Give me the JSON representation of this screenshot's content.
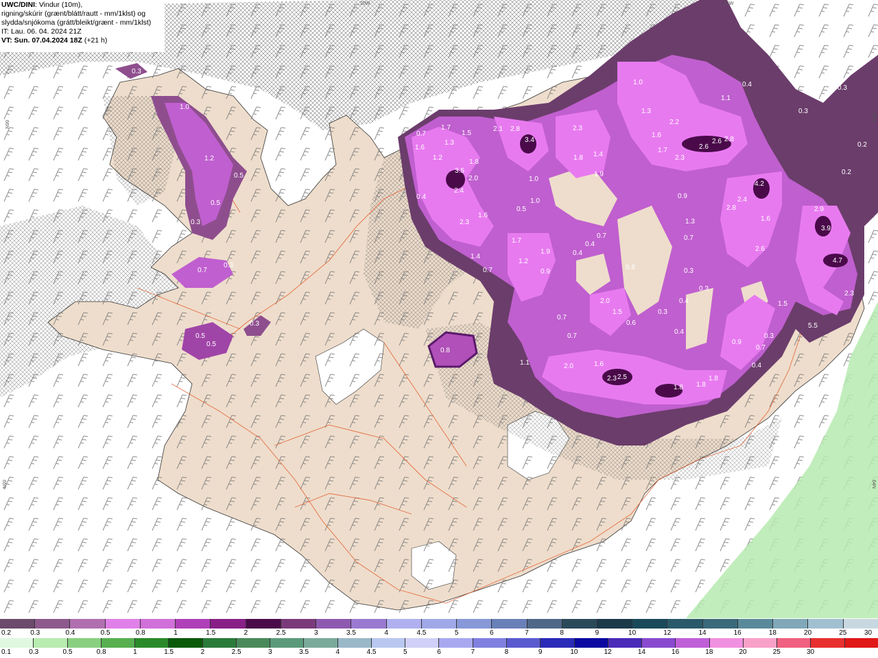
{
  "header": {
    "model": "UWC/DINI",
    "line1_rest": ": Vindur (10m),",
    "line2": "rigning/skúrir (grænt/blátt/rautt - mm/1klst) og",
    "line3": "slydda/snjókoma (grátt/bleikt/grænt - mm/1klst)",
    "init_time": "IT: Lau. 06. 04. 2024 21Z",
    "valid_time": "VT: Sun. 07.04.2024 18Z",
    "lead": "(+21 h)"
  },
  "map_ticks": {
    "top_left": "20W",
    "top_right": "15W",
    "left": "66N",
    "left_lower": "65N",
    "right": "66N",
    "right_lower": "64N"
  },
  "colors": {
    "land": "#eeddcc",
    "sea": "#ffffff",
    "barb": "#7a7a7a",
    "roads": "#e25a2a",
    "precip_light": "#7a3d7a",
    "precip_mid": "#c05fcf",
    "precip_high": "#e87af0",
    "precip_core": "#5a1a6a",
    "rain_green": "#b6eab0"
  },
  "value_labels": [
    "0.3",
    "1.0",
    "1.2",
    "0.5",
    "0.5",
    "0.3",
    "0.7",
    "0.3",
    "0.3",
    "0.5",
    "0.5",
    "0.8",
    "0.7",
    "1.7",
    "1.5",
    "1.6",
    "1.3",
    "1.2",
    "2.1",
    "2.8",
    "3.4",
    "3.5",
    "2.0",
    "1.8",
    "2.4",
    "0.4",
    "2.3",
    "1.6",
    "1.4",
    "0.7",
    "2.3",
    "1.8",
    "1.4",
    "1.9",
    "1.0",
    "0.5",
    "1.0",
    "1.7",
    "1.2",
    "1.9",
    "0.9",
    "1.0",
    "1.3",
    "1.1",
    "0.4",
    "0.3",
    "0.3",
    "0.2",
    "0.2",
    "2.2",
    "1.6",
    "1.7",
    "2.6",
    "2.6",
    "2.8",
    "2.3",
    "0.9",
    "4.2",
    "2.8",
    "2.4",
    "1.6",
    "2.9",
    "3.9",
    "1.3",
    "0.7",
    "2.6",
    "4.7",
    "0.4",
    "0.7",
    "0.8",
    "0.4",
    "2.0",
    "1.5",
    "0.6",
    "0.3",
    "0.4",
    "0.3",
    "0.4",
    "1.5",
    "2.3",
    "5.5",
    "0.3",
    "0.9",
    "0.3",
    "0.7",
    "0.4",
    "0.7",
    "0.7",
    "1.1",
    "2.0",
    "1.6",
    "2.3",
    "2.5",
    "1.8",
    "1.8",
    "1.8"
  ],
  "legend_snow": {
    "labels": [
      "0.2",
      "0.3",
      "0.4",
      "0.5",
      "0.8",
      "1",
      "1.5",
      "2",
      "2.5",
      "3",
      "3.5",
      "4",
      "4.5",
      "5",
      "6",
      "7",
      "8",
      "9",
      "10",
      "12",
      "14",
      "16",
      "18",
      "20",
      "25",
      "30"
    ],
    "colors": [
      "#6b4a6b",
      "#8e5a8e",
      "#b070b0",
      "#e080e8",
      "#d070d8",
      "#b040b8",
      "#882088",
      "#4a0a4a",
      "#7a3a7a",
      "#8e5ab0",
      "#9a7ad0",
      "#b0b0f0",
      "#a0a8e8",
      "#8898d8",
      "#6a80b8",
      "#506888",
      "#2a4a5a",
      "#1a3a4a",
      "#1a4a5a",
      "#2a5a6a",
      "#3a6a7a",
      "#5a8a9a",
      "#80a8b8",
      "#a0c0d0",
      "#c8d8e0"
    ]
  },
  "legend_rain": {
    "labels": [
      "0.1",
      "0.3",
      "0.5",
      "0.8",
      "1",
      "1.5",
      "2",
      "2.5",
      "3",
      "3.5",
      "4",
      "4.5",
      "5",
      "6",
      "7",
      "8",
      "9",
      "10",
      "12",
      "14",
      "16",
      "18",
      "20",
      "25",
      "30"
    ],
    "colors": [
      "#e0f8e0",
      "#b8ecb0",
      "#88d080",
      "#58b050",
      "#2a8a2a",
      "#0a5a0a",
      "#2a7a3a",
      "#4a8a5a",
      "#5a9a7a",
      "#7aaa9a",
      "#9ab8c8",
      "#b8c8f0",
      "#d0d0f8",
      "#a8a8f0",
      "#8080e0",
      "#5a5ad0",
      "#2a2ab8",
      "#0a0aa0",
      "#4a2ab8",
      "#8a4ad0",
      "#c060d8",
      "#f090e0",
      "#f8a0c8",
      "#f06080",
      "#e83030",
      "#e01818"
    ]
  }
}
